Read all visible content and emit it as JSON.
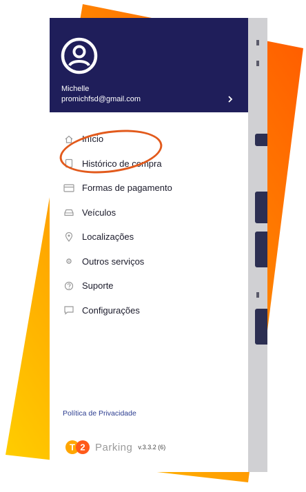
{
  "user": {
    "name": "Michelle",
    "email": "promichfsd@gmail.com"
  },
  "menu": [
    {
      "label": "Início",
      "icon": "home-icon"
    },
    {
      "label": "Histórico de compra",
      "icon": "receipt-icon"
    },
    {
      "label": "Formas de pagamento",
      "icon": "credit-card-icon"
    },
    {
      "label": "Veículos",
      "icon": "car-icon"
    },
    {
      "label": "Localizações",
      "icon": "location-pin-icon"
    },
    {
      "label": "Outros serviços",
      "icon": "services-icon"
    },
    {
      "label": "Suporte",
      "icon": "help-icon"
    },
    {
      "label": "Configurações",
      "icon": "chat-settings-icon"
    }
  ],
  "privacy_label": "Política de Privacidade",
  "brand": {
    "logo_letters": "T2",
    "name": "Parking",
    "version": "v.3.3.2 (6)"
  },
  "colors": {
    "header_bg": "#1f1e5a",
    "highlight": "#e25a1c",
    "orange": "#ff6a00",
    "yellow": "#ffb300"
  }
}
